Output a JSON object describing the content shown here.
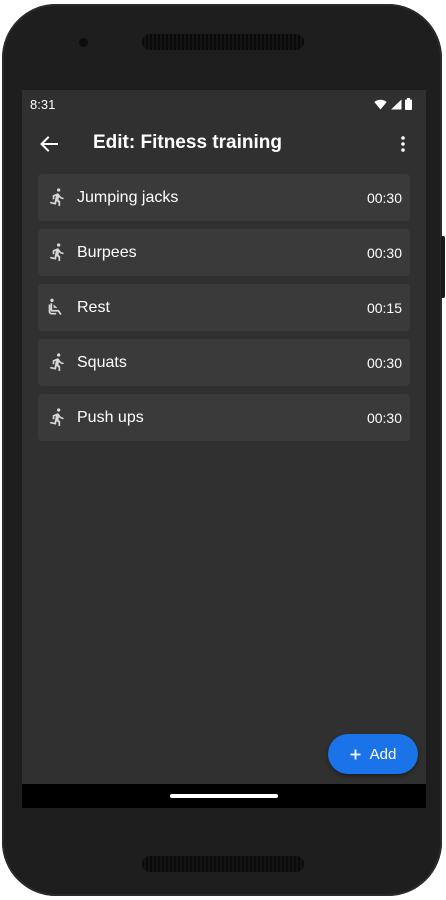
{
  "status_bar": {
    "time": "8:31",
    "icons": [
      "wifi-icon",
      "cell-signal-icon",
      "battery-icon"
    ]
  },
  "toolbar": {
    "back_icon": "arrow-back-icon",
    "title": "Edit: Fitness training",
    "menu_icon": "more-vert-icon"
  },
  "exercises": [
    {
      "label": "Jumping jacks",
      "duration": "00:30",
      "icon": "run-icon"
    },
    {
      "label": "Burpees",
      "duration": "00:30",
      "icon": "run-icon"
    },
    {
      "label": "Rest",
      "duration": "00:15",
      "icon": "seat-icon"
    },
    {
      "label": "Squats",
      "duration": "00:30",
      "icon": "run-icon"
    },
    {
      "label": "Push ups",
      "duration": "00:30",
      "icon": "run-icon"
    }
  ],
  "fab": {
    "icon": "plus-icon",
    "label": "Add"
  },
  "colors": {
    "background": "#303030",
    "item_background": "#3a3a3a",
    "accent": "#1a73e8",
    "text": "#ffffff"
  }
}
